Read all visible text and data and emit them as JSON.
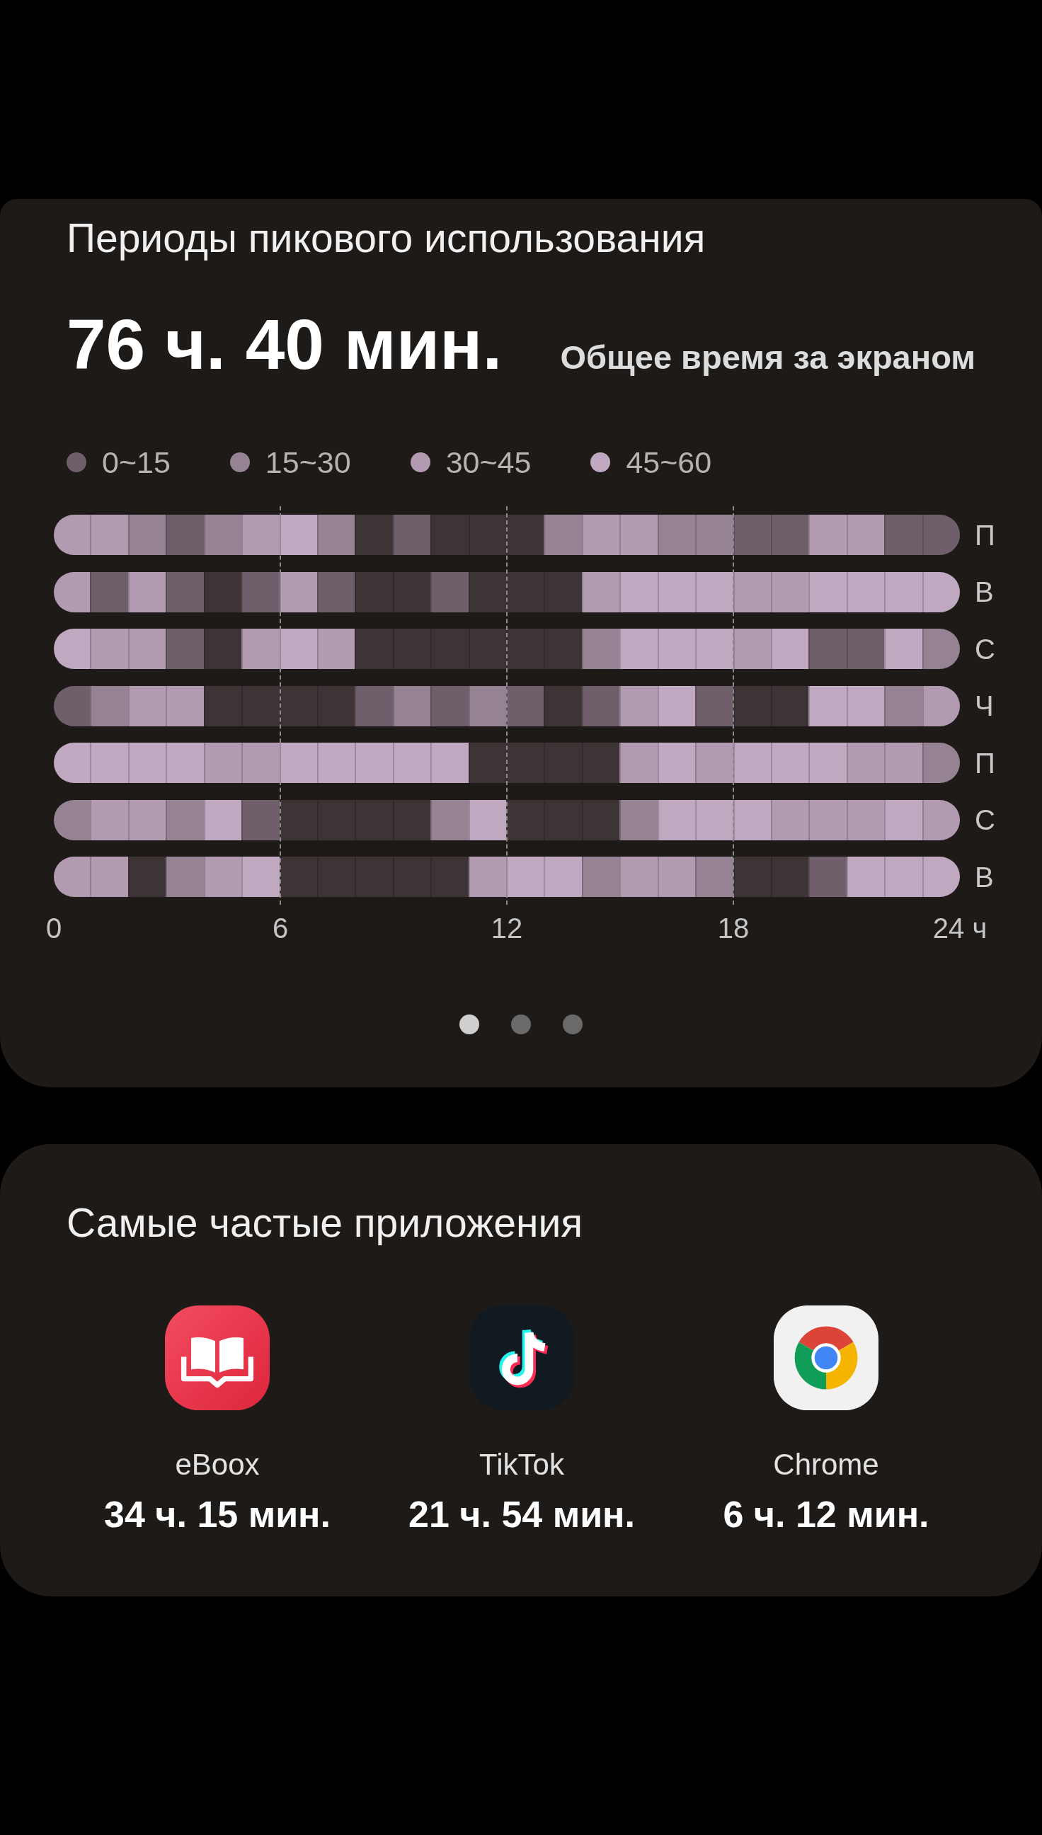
{
  "peak_usage": {
    "title": "Периоды пикового использования",
    "total_time": "76 ч. 40 мин.",
    "total_label": "Общее время за экраном",
    "legend": [
      {
        "label": "0~15",
        "color": "#6e5f6a"
      },
      {
        "label": "15~30",
        "color": "#958293"
      },
      {
        "label": "30~45",
        "color": "#b29bb1"
      },
      {
        "label": "45~60",
        "color": "#c0a8c1"
      }
    ],
    "heatmap": {
      "rows": [
        {
          "day": "П",
          "cells": [
            {
              "color": "#b29bb1"
            },
            {
              "color": "#b29bb1"
            },
            {
              "color": "#958293"
            },
            {
              "color": "#6e5f6a"
            },
            {
              "color": "#958293"
            },
            {
              "color": "#b29bb1"
            },
            {
              "color": "#c0a8c1"
            },
            {
              "color": "#958293"
            },
            {
              "color": "#3d3436"
            },
            {
              "color": "#6e5f6a"
            },
            {
              "color": "#3d3436"
            },
            {
              "color": "#3d3436"
            },
            {
              "color": "#3d3436"
            },
            {
              "color": "#958293"
            },
            {
              "color": "#b29bb1"
            },
            {
              "color": "#b29bb1"
            },
            {
              "color": "#958293"
            },
            {
              "color": "#958293"
            },
            {
              "color": "#6e5f6a"
            },
            {
              "color": "#6e5f6a"
            },
            {
              "color": "#b29bb1"
            },
            {
              "color": "#b29bb1"
            },
            {
              "color": "#6e5f6a"
            },
            {
              "color": "#6e5f6a"
            }
          ]
        },
        {
          "day": "В",
          "cells": [
            {
              "color": "#b29bb1"
            },
            {
              "color": "#6e5f6a"
            },
            {
              "color": "#b29bb1"
            },
            {
              "color": "#6e5f6a"
            },
            {
              "color": "#3d3436"
            },
            {
              "color": "#6e5f6a"
            },
            {
              "color": "#b29bb1"
            },
            {
              "color": "#6e5f6a"
            },
            {
              "color": "#3d3436"
            },
            {
              "color": "#3d3436"
            },
            {
              "color": "#6e5f6a"
            },
            {
              "color": "#3d3436"
            },
            {
              "color": "#3d3436"
            },
            {
              "color": "#3d3436"
            },
            {
              "color": "#b29bb1"
            },
            {
              "color": "#c0a8c1"
            },
            {
              "color": "#c0a8c1"
            },
            {
              "color": "#c0a8c1"
            },
            {
              "color": "#b29bb1"
            },
            {
              "color": "#b29bb1"
            },
            {
              "color": "#c0a8c1"
            },
            {
              "color": "#c0a8c1"
            },
            {
              "color": "#c0a8c1"
            },
            {
              "color": "#c0a8c1"
            }
          ]
        },
        {
          "day": "С",
          "cells": [
            {
              "color": "#c0a8c1"
            },
            {
              "color": "#b29bb1"
            },
            {
              "color": "#b29bb1"
            },
            {
              "color": "#6e5f6a"
            },
            {
              "color": "#3d3436"
            },
            {
              "color": "#b29bb1"
            },
            {
              "color": "#c0a8c1"
            },
            {
              "color": "#b29bb1"
            },
            {
              "color": "#3d3436"
            },
            {
              "color": "#3d3436"
            },
            {
              "color": "#3d3436"
            },
            {
              "color": "#3d3436"
            },
            {
              "color": "#3d3436"
            },
            {
              "color": "#3d3436"
            },
            {
              "color": "#958293"
            },
            {
              "color": "#c0a8c1"
            },
            {
              "color": "#c0a8c1"
            },
            {
              "color": "#c0a8c1"
            },
            {
              "color": "#b29bb1"
            },
            {
              "color": "#c0a8c1"
            },
            {
              "color": "#6e5f6a"
            },
            {
              "color": "#6e5f6a"
            },
            {
              "color": "#c0a8c1"
            },
            {
              "color": "#958293"
            }
          ]
        },
        {
          "day": "Ч",
          "cells": [
            {
              "color": "#6e5f6a"
            },
            {
              "color": "#958293"
            },
            {
              "color": "#b29bb1"
            },
            {
              "color": "#b29bb1"
            },
            {
              "color": "#3d3436"
            },
            {
              "color": "#3d3436"
            },
            {
              "color": "#3d3436"
            },
            {
              "color": "#3d3436"
            },
            {
              "color": "#6e5f6a"
            },
            {
              "color": "#958293"
            },
            {
              "color": "#6e5f6a"
            },
            {
              "color": "#958293"
            },
            {
              "color": "#6e5f6a"
            },
            {
              "color": "#3d3436"
            },
            {
              "color": "#6e5f6a"
            },
            {
              "color": "#b29bb1"
            },
            {
              "color": "#c0a8c1"
            },
            {
              "color": "#6e5f6a"
            },
            {
              "color": "#3d3436"
            },
            {
              "color": "#3d3436"
            },
            {
              "color": "#c0a8c1"
            },
            {
              "color": "#c0a8c1"
            },
            {
              "color": "#958293"
            },
            {
              "color": "#b29bb1"
            }
          ]
        },
        {
          "day": "П",
          "cells": [
            {
              "color": "#c0a8c1"
            },
            {
              "color": "#c0a8c1"
            },
            {
              "color": "#c0a8c1"
            },
            {
              "color": "#c0a8c1"
            },
            {
              "color": "#b29bb1"
            },
            {
              "color": "#b29bb1"
            },
            {
              "color": "#c0a8c1"
            },
            {
              "color": "#c0a8c1"
            },
            {
              "color": "#c0a8c1"
            },
            {
              "color": "#c0a8c1"
            },
            {
              "color": "#c0a8c1"
            },
            {
              "color": "#3d3436"
            },
            {
              "color": "#3d3436"
            },
            {
              "color": "#3d3436"
            },
            {
              "color": "#3d3436"
            },
            {
              "color": "#b29bb1"
            },
            {
              "color": "#c0a8c1"
            },
            {
              "color": "#b29bb1"
            },
            {
              "color": "#c0a8c1"
            },
            {
              "color": "#c0a8c1"
            },
            {
              "color": "#c0a8c1"
            },
            {
              "color": "#b29bb1"
            },
            {
              "color": "#b29bb1"
            },
            {
              "color": "#958293"
            }
          ]
        },
        {
          "day": "С",
          "cells": [
            {
              "color": "#958293"
            },
            {
              "color": "#b29bb1"
            },
            {
              "color": "#b29bb1"
            },
            {
              "color": "#958293"
            },
            {
              "color": "#c0a8c1"
            },
            {
              "color": "#6e5f6a"
            },
            {
              "color": "#3d3436"
            },
            {
              "color": "#3d3436"
            },
            {
              "color": "#3d3436"
            },
            {
              "color": "#3d3436"
            },
            {
              "color": "#958293"
            },
            {
              "color": "#c0a8c1"
            },
            {
              "color": "#3d3436"
            },
            {
              "color": "#3d3436"
            },
            {
              "color": "#3d3436"
            },
            {
              "color": "#958293"
            },
            {
              "color": "#c0a8c1"
            },
            {
              "color": "#c0a8c1"
            },
            {
              "color": "#c0a8c1"
            },
            {
              "color": "#b29bb1"
            },
            {
              "color": "#b29bb1"
            },
            {
              "color": "#b29bb1"
            },
            {
              "color": "#c0a8c1"
            },
            {
              "color": "#b29bb1"
            }
          ]
        },
        {
          "day": "В",
          "cells": [
            {
              "color": "#b29bb1"
            },
            {
              "color": "#b29bb1"
            },
            {
              "color": "#3d3436"
            },
            {
              "color": "#958293"
            },
            {
              "color": "#b29bb1"
            },
            {
              "color": "#c0a8c1"
            },
            {
              "color": "#3d3436"
            },
            {
              "color": "#3d3436"
            },
            {
              "color": "#3d3436"
            },
            {
              "color": "#3d3436"
            },
            {
              "color": "#3d3436"
            },
            {
              "color": "#b29bb1"
            },
            {
              "color": "#c0a8c1"
            },
            {
              "color": "#c0a8c1"
            },
            {
              "color": "#958293"
            },
            {
              "color": "#b29bb1"
            },
            {
              "color": "#b29bb1"
            },
            {
              "color": "#958293"
            },
            {
              "color": "#3d3436"
            },
            {
              "color": "#3d3436"
            },
            {
              "color": "#6e5f6a"
            },
            {
              "color": "#c0a8c1"
            },
            {
              "color": "#c0a8c1"
            },
            {
              "color": "#c0a8c1"
            }
          ]
        }
      ],
      "x_axis": [
        "0",
        "6",
        "12",
        "18",
        "24 ч"
      ]
    },
    "pager": [
      {
        "selected": true
      },
      {
        "selected": false
      },
      {
        "selected": false
      }
    ]
  },
  "top_apps": {
    "title": "Самые частые приложения",
    "apps": [
      {
        "kind": "book",
        "name": "eBoox",
        "time": "34 ч. 15 мин."
      },
      {
        "kind": "note",
        "name": "TikTok",
        "time": "21 ч. 54 мин."
      },
      {
        "kind": "ring",
        "name": "Chrome",
        "time": "6 ч. 12 мин."
      }
    ]
  }
}
